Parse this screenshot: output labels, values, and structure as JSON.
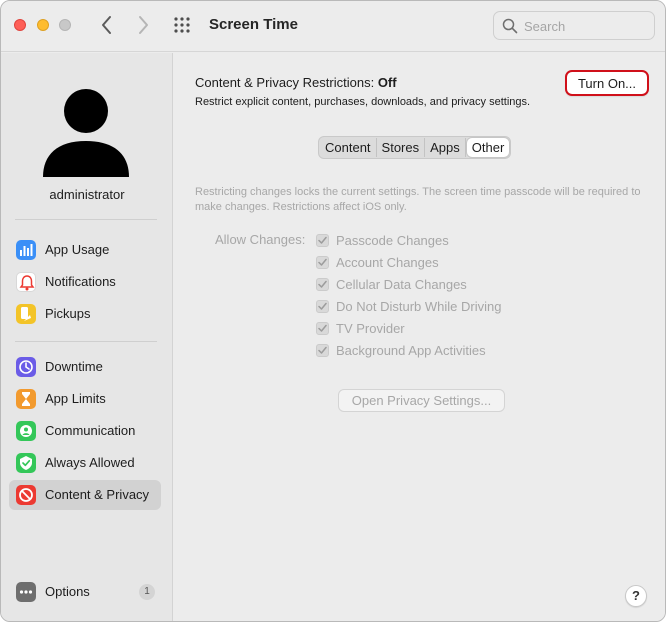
{
  "window": {
    "title": "Screen Time"
  },
  "search": {
    "placeholder": "Search"
  },
  "sidebar": {
    "user": "administrator",
    "items": [
      {
        "label": "App Usage",
        "icon": "bar-chart-icon",
        "color": "#3a8ff7"
      },
      {
        "label": "Notifications",
        "icon": "bell-icon",
        "color": "#ffffff"
      },
      {
        "label": "Pickups",
        "icon": "pickup-icon",
        "color": "#f3c428"
      },
      {
        "label": "Downtime",
        "icon": "downtime-icon",
        "color": "#6b5ce7"
      },
      {
        "label": "App Limits",
        "icon": "hourglass-icon",
        "color": "#f29a2e"
      },
      {
        "label": "Communication",
        "icon": "communication-icon",
        "color": "#34c759"
      },
      {
        "label": "Always Allowed",
        "icon": "checkmark-shield-icon",
        "color": "#34c759"
      },
      {
        "label": "Content & Privacy",
        "icon": "prohibited-icon",
        "color": "#ec3a32",
        "selected": true
      },
      {
        "label": "Options",
        "icon": "more-icon",
        "color": "#6e6e6e",
        "badge": "1"
      }
    ]
  },
  "main": {
    "heading_prefix": "Content & Privacy Restrictions:",
    "heading_status": "Off",
    "subheading": "Restrict explicit content, purchases, downloads, and privacy settings.",
    "turn_on_label": "Turn On...",
    "tabs": [
      {
        "label": "Content"
      },
      {
        "label": "Stores"
      },
      {
        "label": "Apps"
      },
      {
        "label": "Other",
        "active": true
      }
    ],
    "info": "Restricting changes locks the current settings. The screen time passcode will be required to make changes. Restrictions affect iOS only.",
    "allow_label": "Allow Changes:",
    "checkboxes": [
      {
        "label": "Passcode Changes",
        "checked": true
      },
      {
        "label": "Account Changes",
        "checked": true
      },
      {
        "label": "Cellular Data Changes",
        "checked": true
      },
      {
        "label": "Do Not Disturb While Driving",
        "checked": true
      },
      {
        "label": "TV Provider",
        "checked": true
      },
      {
        "label": "Background App Activities",
        "checked": true
      }
    ],
    "privacy_button": "Open Privacy Settings...",
    "help": "?"
  },
  "colors": {
    "highlight": "#d0101a",
    "sidebar_selected": "#d2d2d2"
  }
}
